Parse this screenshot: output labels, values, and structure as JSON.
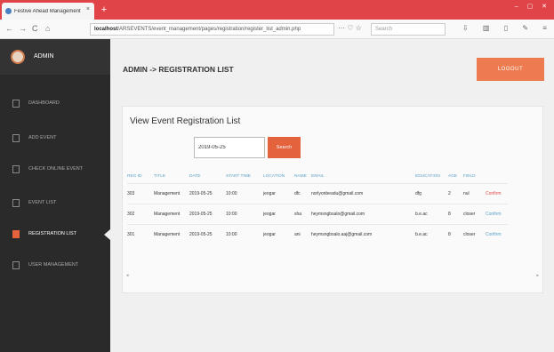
{
  "browser": {
    "tab_title": "Festive Ahead Management",
    "tab_close": "×",
    "new_tab": "+",
    "window_controls": "– ▢ ✕",
    "nav_back": "←",
    "nav_forward": "→",
    "nav_reload": "C",
    "nav_home": "⌂",
    "url_host": "localhost",
    "url_path": "/ARSEVENTS/event_management/pages/registration/register_list_admin.php",
    "url_icons": "··· ♡ ☆",
    "search_placeholder": "Search",
    "tools": "⇩ ▥ ▯ ✎ ≡"
  },
  "sidebar": {
    "brand_label": "ADMIN",
    "items": [
      {
        "label": "DASHBOARD",
        "active": false
      },
      {
        "label": "ADD EVENT",
        "active": false
      },
      {
        "label": "CHECK ONLINE EVENT",
        "active": false
      },
      {
        "label": "EVENT LIST",
        "active": false
      },
      {
        "label": "REGISTRATION LIST",
        "active": true
      },
      {
        "label": "USER MANAGEMENT",
        "active": false
      }
    ]
  },
  "header": {
    "breadcrumb": "ADMIN -> REGISTRATION LIST",
    "logout_label": "LOGOUT"
  },
  "panel": {
    "title": "View Event Registration List",
    "date_value": "2019-05-25",
    "search_label": "Search"
  },
  "table": {
    "columns": [
      "REG ID",
      "TITLE",
      "DATE",
      "START TIME",
      "LOCATION",
      "NAME",
      "EMAIL",
      "EDUCATION",
      "AGE",
      "FIELD",
      ""
    ],
    "rows": [
      [
        "303",
        "Management",
        "2019-05-25",
        "10:00",
        "jeogar",
        "dfc",
        "norlyonbeadu@gmail.com",
        "dfg",
        "2",
        "nul",
        "Confirm"
      ],
      [
        "302",
        "Management",
        "2019-05-25",
        "10:00",
        "jeogar",
        "sha",
        "heymsngbsalo@gmail.com",
        "b.e.ac",
        "8",
        "closer",
        "Confirm"
      ],
      [
        "301",
        "Management",
        "2019-05-25",
        "10:00",
        "jeogar",
        "ani",
        "heymsngbsalo.aaj@gmail.com",
        "b.e.ac",
        "8",
        "closer",
        "Confirm"
      ]
    ]
  },
  "scroll": {
    "left": "◂",
    "right": "▸"
  },
  "colors": {
    "accent": "#e4623c",
    "tabbar": "#e04448",
    "sidebar": "#2a2a2a",
    "header_text": "#5aa0c8"
  }
}
